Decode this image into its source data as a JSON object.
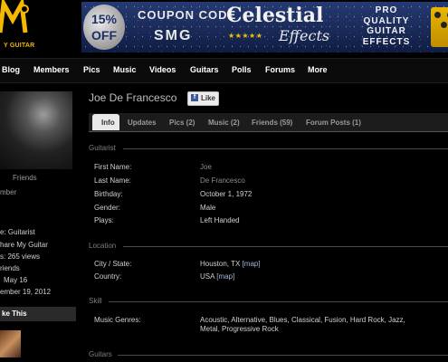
{
  "header": {
    "logo_text": "Y GUITAR",
    "banner": {
      "badge_line1": "15%",
      "badge_line2": "OFF",
      "coupon_line1": "COUPON CODE",
      "coupon_line2": "SMG",
      "brand": "Celestial",
      "brand_sub": "Effects",
      "stars": "★★★★★",
      "pro_lines": [
        "PRO",
        "QUALITY",
        "GUITAR",
        "EFFECTS"
      ]
    }
  },
  "nav": [
    "Blog",
    "Members",
    "Pics",
    "Music",
    "Videos",
    "Guitars",
    "Polls",
    "Forums",
    "More"
  ],
  "sidebar": {
    "friends_label": "Friends",
    "member_label": "mber",
    "lines": [
      "e: Guitarist",
      "hare My Guitar",
      "s: 265 views",
      "riends",
      "May 16",
      "ember 19, 2012"
    ],
    "like_this": "ke This"
  },
  "profile": {
    "name": "Joe De Francesco",
    "like_label": "Like",
    "tabs": [
      "Info",
      "Updates",
      "Pics (2)",
      "Music (2)",
      "Friends (59)",
      "Forum Posts (1)"
    ]
  },
  "guitarist": {
    "title": "Guitarist",
    "fields": [
      {
        "label": "First Name:",
        "value": "Joe"
      },
      {
        "label": "Last Name:",
        "value": "De Francesco"
      },
      {
        "label": "Birthday:",
        "value": "October 1, 1972"
      },
      {
        "label": "Gender:",
        "value": "Male"
      },
      {
        "label": "Plays:",
        "value": "Left Handed"
      }
    ]
  },
  "location": {
    "title": "Location",
    "city_label": "City / State:",
    "city_value": "Houston, TX",
    "country_label": "Country:",
    "country_value": "USA",
    "map_link": "[map]"
  },
  "skill": {
    "title": "Skill",
    "genres_label": "Music Genres:",
    "genres_line1": "Acoustic, Alternative, Blues, Classical, Fusion, Hard Rock, Jazz,",
    "genres_line2": "Metal, Progressive Rock"
  },
  "guitars": {
    "title": "Guitars"
  }
}
